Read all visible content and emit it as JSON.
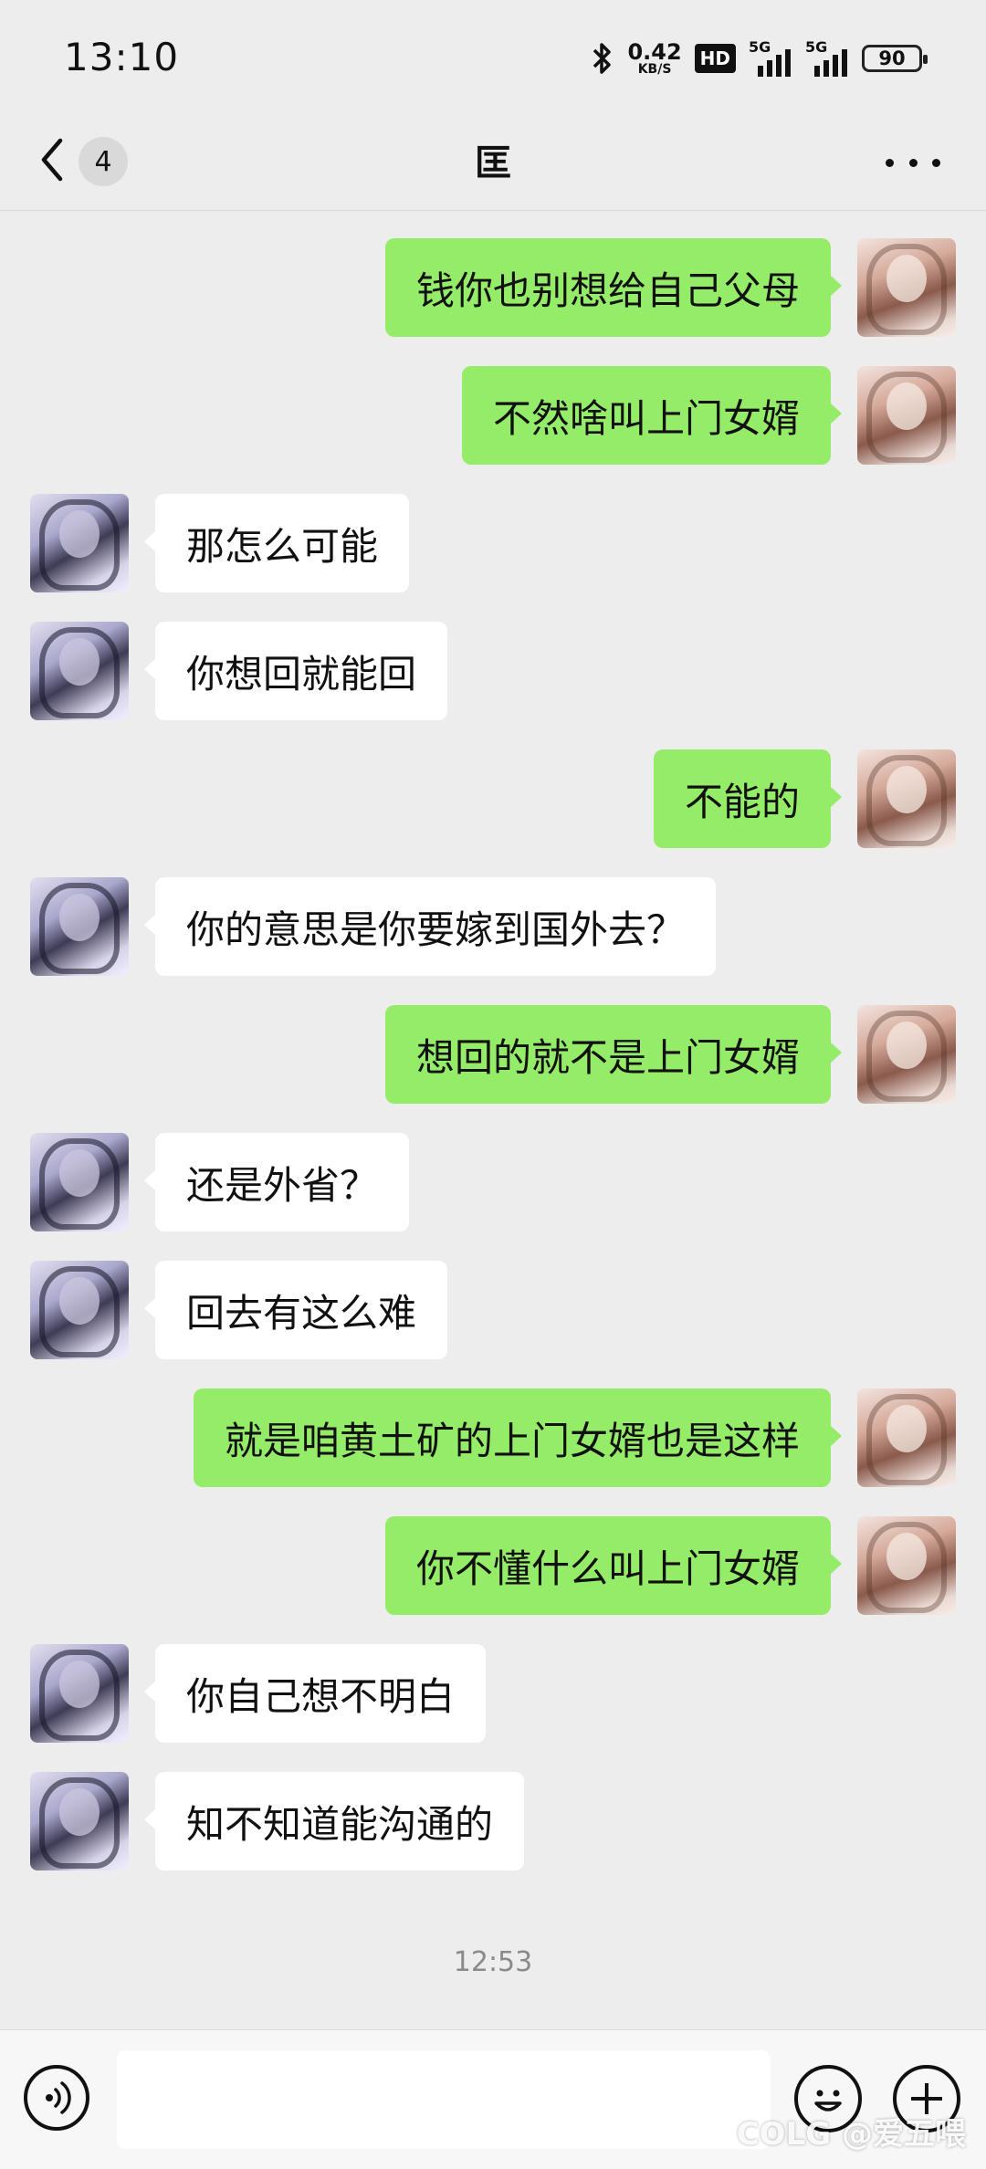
{
  "status_bar": {
    "time": "13:10",
    "net_speed_value": "0.42",
    "net_speed_unit": "KB/S",
    "hd_label": "HD",
    "signal_1_label": "5G",
    "signal_2_label": "5G",
    "battery_level": "90"
  },
  "nav": {
    "unread_count": "4",
    "title": "匡"
  },
  "messages": [
    {
      "side": "me",
      "text": "钱你也别想给自己父母"
    },
    {
      "side": "me",
      "text": "不然啥叫上门女婿"
    },
    {
      "side": "other",
      "text": "那怎么可能"
    },
    {
      "side": "other",
      "text": "你想回就能回"
    },
    {
      "side": "me",
      "text": "不能的"
    },
    {
      "side": "other",
      "text": "你的意思是你要嫁到国外去？"
    },
    {
      "side": "me",
      "text": "想回的就不是上门女婿"
    },
    {
      "side": "other",
      "text": "还是外省？"
    },
    {
      "side": "other",
      "text": "回去有这么难"
    },
    {
      "side": "me",
      "text": "就是咱黄土矿的上门女婿也是这样"
    },
    {
      "side": "me",
      "text": "你不懂什么叫上门女婿"
    },
    {
      "side": "other",
      "text": "你自己想不明白"
    },
    {
      "side": "other",
      "text": "知不知道能沟通的"
    }
  ],
  "timestamp": "12:53",
  "input": {
    "value": "",
    "placeholder": ""
  },
  "watermark": "COLG @爱五喂",
  "colors": {
    "background": "#ededed",
    "my_bubble": "#95ec69",
    "other_bubble": "#ffffff"
  },
  "icons": [
    "back-chevron-icon",
    "more-icon",
    "voice-icon",
    "emoji-icon",
    "plus-icon"
  ]
}
